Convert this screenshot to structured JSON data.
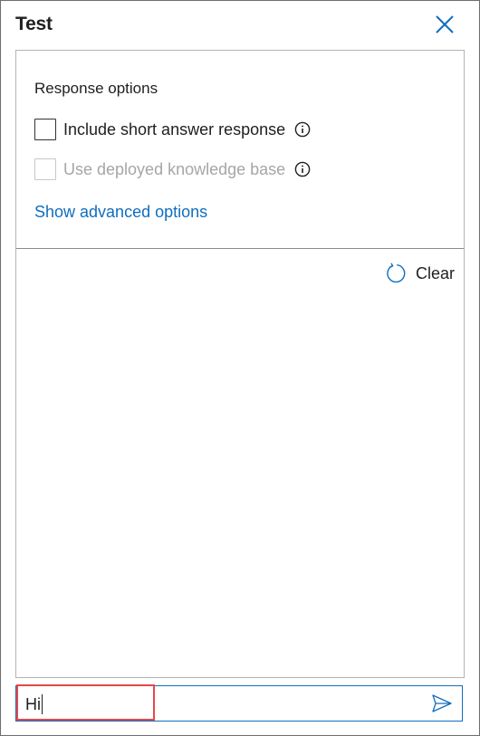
{
  "panel": {
    "title": "Test",
    "close_icon": "close-icon"
  },
  "response_options": {
    "heading": "Response options",
    "options": [
      {
        "label": "Include short answer response",
        "checked": false,
        "disabled": false,
        "info_icon": "info-icon"
      },
      {
        "label": "Use deployed knowledge base",
        "checked": false,
        "disabled": true,
        "info_icon": "info-icon"
      }
    ],
    "advanced_link": "Show advanced options"
  },
  "chat": {
    "clear_label": "Clear",
    "clear_icon": "refresh-icon"
  },
  "input": {
    "value": "Hi",
    "send_icon": "send-icon"
  },
  "colors": {
    "link": "#106ebe",
    "accent_border": "#106ebe",
    "highlight": "#e8474b",
    "disabled_text": "#a6a6a6"
  }
}
